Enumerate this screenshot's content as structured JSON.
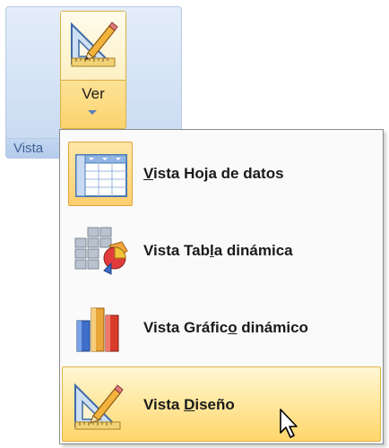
{
  "ribbon_group": {
    "label": "Vista",
    "button": {
      "label": "Ver",
      "icon": "triangle-ruler-pencil-icon"
    }
  },
  "menu": {
    "items": [
      {
        "prefix": "",
        "mnemonic": "V",
        "suffix": "ista Hoja de datos",
        "icon": "datasheet-grid-icon",
        "selected": true,
        "hovered": false
      },
      {
        "prefix": "Vista Tab",
        "mnemonic": "l",
        "suffix": "a dinámica",
        "icon": "pivot-table-icon",
        "selected": false,
        "hovered": false
      },
      {
        "prefix": "Vista Gráfic",
        "mnemonic": "o",
        "suffix": " dinámico",
        "icon": "pivot-chart-icon",
        "selected": false,
        "hovered": false
      },
      {
        "prefix": "Vista ",
        "mnemonic": "D",
        "suffix": "iseño",
        "icon": "design-triangle-ruler-icon",
        "selected": false,
        "hovered": true
      }
    ]
  },
  "colors": {
    "ribbon_background": "#d3e2f5",
    "group_label_text": "#3e5f94",
    "highlight_orange": "#ffd66b",
    "menu_background": "#fafafa"
  }
}
